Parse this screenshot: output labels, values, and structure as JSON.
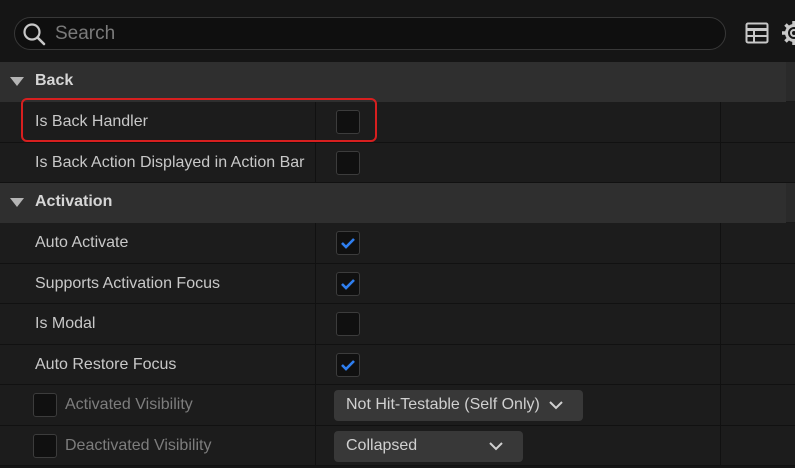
{
  "search": {
    "placeholder": "Search"
  },
  "icons": {
    "search": "search-icon",
    "table": "table-view-icon",
    "settings": "gear-icon",
    "caret": "caret-down-icon",
    "check": "checkmark-icon",
    "chevron": "chevron-down-icon"
  },
  "colors": {
    "accent_check": "#2f7ff0",
    "highlight": "#d71f1f"
  },
  "categories": [
    {
      "label": "Back",
      "properties": [
        {
          "label": "Is Back Handler",
          "checked": false
        },
        {
          "label": "Is Back Action Displayed in Action Bar",
          "checked": false
        }
      ]
    },
    {
      "label": "Activation",
      "properties": [
        {
          "label": "Auto Activate",
          "checked": true
        },
        {
          "label": "Supports Activation Focus",
          "checked": true
        },
        {
          "label": "Is Modal",
          "checked": false
        },
        {
          "label": "Auto Restore Focus",
          "checked": true
        },
        {
          "label": "Activated Visibility",
          "edit_enabled": false,
          "value": "Not Hit-Testable (Self Only)"
        },
        {
          "label": "Deactivated Visibility",
          "edit_enabled": false,
          "value": "Collapsed"
        }
      ]
    }
  ]
}
